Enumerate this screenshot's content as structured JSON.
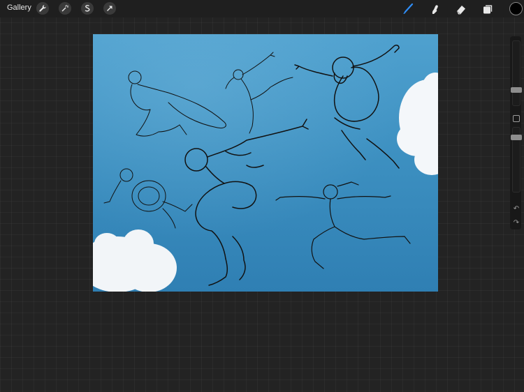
{
  "topbar": {
    "gallery_label": "Gallery",
    "left_tools": [
      "wrench-icon",
      "magic-wand-icon",
      "selection-icon",
      "transform-arrow-icon"
    ],
    "right_tools": [
      "brush-icon",
      "smudge-icon",
      "eraser-icon",
      "layers-icon"
    ],
    "active_tool": "brush-icon",
    "active_color": "#000000"
  },
  "colors": {
    "accent": "#2f8df6",
    "background": "#232323",
    "sky": "#3f93c4"
  },
  "sidebar": {
    "brush_size": 0.35,
    "opacity": 0.6,
    "undo_icon": "undo-arrow-icon",
    "redo_icon": "redo-arrow-icon"
  }
}
